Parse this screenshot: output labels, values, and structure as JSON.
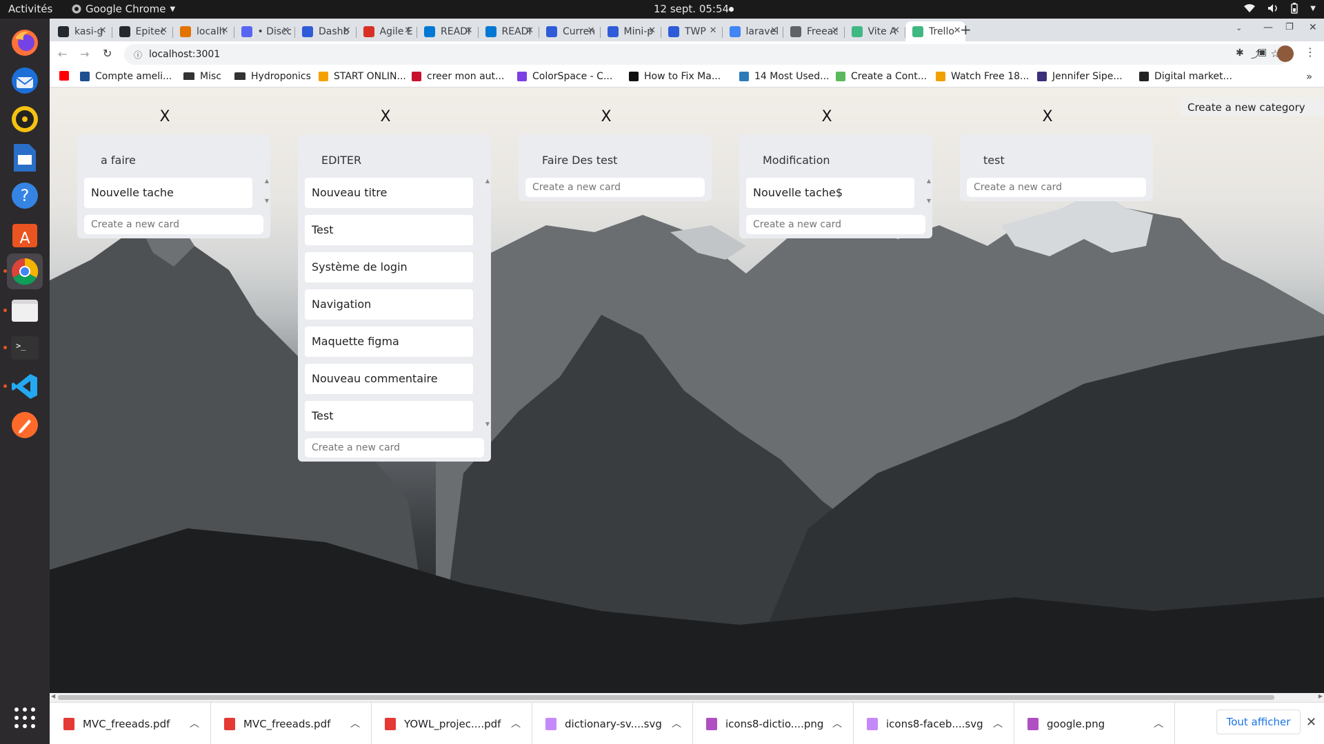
{
  "system": {
    "activities": "Activités",
    "app": "Google Chrome",
    "clock": "12 sept.  05:54"
  },
  "tabs": [
    {
      "label": "kasi-g",
      "color": "#24292f"
    },
    {
      "label": "Epitec",
      "color": "#24292f"
    },
    {
      "label": "localh",
      "color": "#e37400"
    },
    {
      "label": "• Disco",
      "color": "#5865f2"
    },
    {
      "label": "Dashb",
      "color": "#2f5bd8"
    },
    {
      "label": "Agile E",
      "color": "#d93025"
    },
    {
      "label": "READI",
      "color": "#0078d4"
    },
    {
      "label": "READI",
      "color": "#0078d4"
    },
    {
      "label": "Curren",
      "color": "#2f5bd8"
    },
    {
      "label": "Mini-p",
      "color": "#2f5bd8"
    },
    {
      "label": "TWP",
      "color": "#2f5bd8"
    },
    {
      "label": "laravel",
      "color": "#4285f4"
    },
    {
      "label": "Freeac",
      "color": "#5f6368"
    },
    {
      "label": "Vite A",
      "color": "#41b883"
    },
    {
      "label": "Trello",
      "color": "#41b883"
    }
  ],
  "new_tab": "+",
  "address": "localhost:3001",
  "bookmarks": [
    {
      "label": "",
      "color": "#ff0000"
    },
    {
      "label": "Compte ameli...",
      "color": "#1d4f91"
    },
    {
      "label": "Misc",
      "color": "#333333"
    },
    {
      "label": "Hydroponics",
      "color": "#333333"
    },
    {
      "label": "START ONLIN...",
      "color": "#f4a100"
    },
    {
      "label": "creer mon aut...",
      "color": "#c8102e"
    },
    {
      "label": "ColorSpace - C...",
      "color": "#7b3fe4"
    },
    {
      "label": "How to Fix Ma...",
      "color": "#111111"
    },
    {
      "label": "14 Most Used...",
      "color": "#2b7bb9"
    },
    {
      "label": "Create a Cont...",
      "color": "#5cb85c"
    },
    {
      "label": "Watch Free 18...",
      "color": "#f0a000"
    },
    {
      "label": "Jennifer Sipe...",
      "color": "#3a2f7a"
    },
    {
      "label": "Digital market...",
      "color": "#222222"
    }
  ],
  "bookmarks_more": "»",
  "board": {
    "new_category": "Create a new category",
    "close_label": "X",
    "new_card_placeholder": "Create a new card",
    "columns": [
      {
        "title": "a faire",
        "cards": [
          "Nouvelle tache"
        ]
      },
      {
        "title": "EDITER",
        "cards": [
          "Nouveau titre",
          "Test",
          "Système de login",
          "Navigation",
          "Maquette figma",
          "Nouveau commentaire",
          "Test"
        ]
      },
      {
        "title": "Faire Des test",
        "cards": []
      },
      {
        "title": "Modification",
        "cards": [
          "Nouvelle tache$"
        ]
      },
      {
        "title": "test",
        "cards": []
      }
    ]
  },
  "downloads": [
    {
      "name": "MVC_freeads.pdf",
      "color": "#e53935"
    },
    {
      "name": "MVC_freeads.pdf",
      "color": "#e53935"
    },
    {
      "name": "YOWL_projec....pdf",
      "color": "#e53935"
    },
    {
      "name": "dictionary-sv....svg",
      "color": "#c58af9"
    },
    {
      "name": "icons8-dictio....png",
      "color": "#b04fc2"
    },
    {
      "name": "icons8-faceb....svg",
      "color": "#c58af9"
    },
    {
      "name": "google.png",
      "color": "#b04fc2"
    }
  ],
  "show_all": "Tout afficher"
}
